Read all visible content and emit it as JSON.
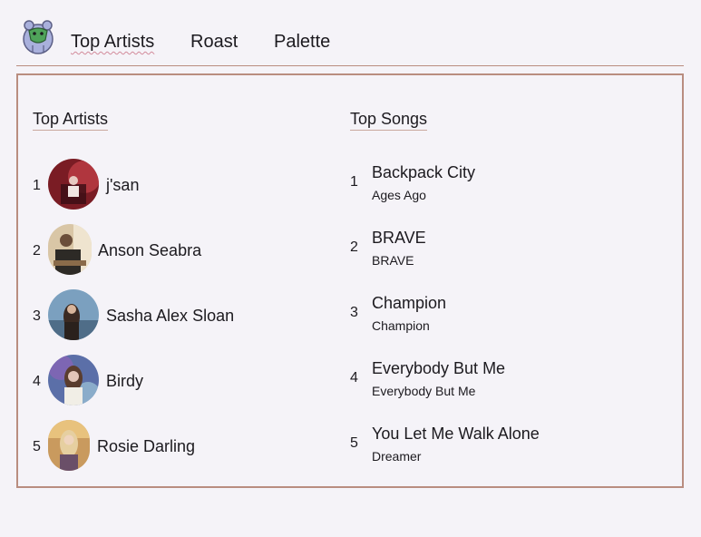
{
  "nav": {
    "logo_icon": "bear-icon",
    "items": [
      {
        "label": "Top Artists",
        "active": true
      },
      {
        "label": "Roast",
        "active": false
      },
      {
        "label": "Palette",
        "active": false
      }
    ]
  },
  "artists": {
    "heading": "Top Artists",
    "items": [
      {
        "rank": "1",
        "name": "j'san"
      },
      {
        "rank": "2",
        "name": "Anson Seabra"
      },
      {
        "rank": "3",
        "name": "Sasha Alex Sloan"
      },
      {
        "rank": "4",
        "name": "Birdy"
      },
      {
        "rank": "5",
        "name": "Rosie Darling"
      }
    ]
  },
  "songs": {
    "heading": "Top Songs",
    "items": [
      {
        "rank": "1",
        "title": "Backpack City",
        "album": "Ages Ago"
      },
      {
        "rank": "2",
        "title": "BRAVE",
        "album": "BRAVE"
      },
      {
        "rank": "3",
        "title": "Champion",
        "album": "Champion"
      },
      {
        "rank": "4",
        "title": "Everybody But Me",
        "album": "Everybody But Me"
      },
      {
        "rank": "5",
        "title": "You Let Me Walk Alone",
        "album": "Dreamer"
      }
    ]
  },
  "colors": {
    "background": "#f5f3f8",
    "border": "#b98d80",
    "active_underline": "#d28a9a",
    "text": "#1c1a1f"
  }
}
